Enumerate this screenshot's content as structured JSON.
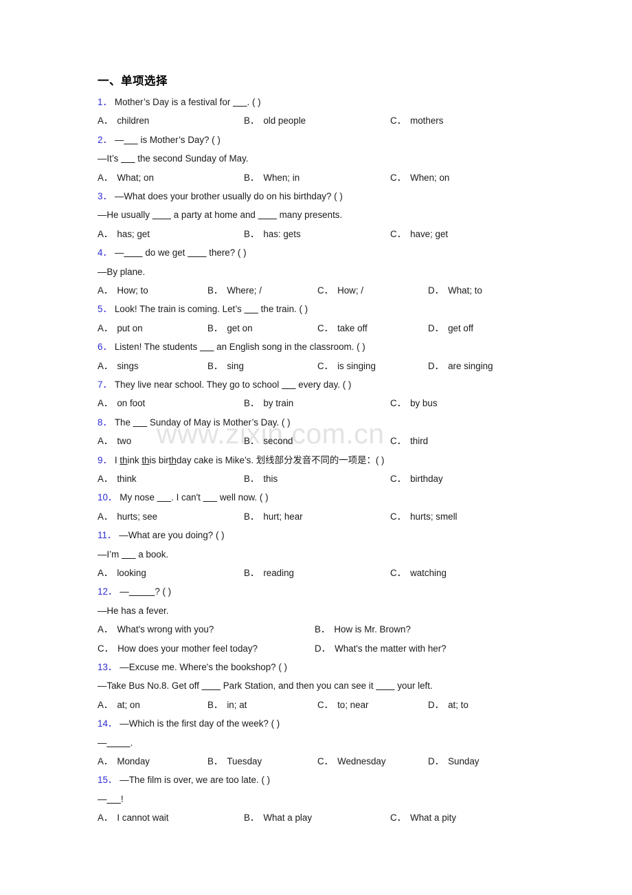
{
  "document": {
    "section_title": "一、单项选择",
    "watermark": "www.zixin.com.cn"
  },
  "questions": [
    {
      "num": "1．",
      "stem": "Mother’s Day is a festival for ______. (   )",
      "cont": null,
      "layout": "c3",
      "options": [
        {
          "letter": "A．",
          "text": "children"
        },
        {
          "letter": "B．",
          "text": "old people"
        },
        {
          "letter": "C．",
          "text": "mothers"
        }
      ]
    },
    {
      "num": "2．",
      "stem": "—______ is Mother’s Day? (   )",
      "cont": "—It’s ______ the second Sunday of May.",
      "layout": "c3",
      "options": [
        {
          "letter": "A．",
          "text": "What; on"
        },
        {
          "letter": "B．",
          "text": "When; in"
        },
        {
          "letter": "C．",
          "text": "When; on"
        }
      ]
    },
    {
      "num": "3．",
      "stem": "—What does your brother usually do on his birthday? (   )",
      "cont": "—He usually ________ a party at home and ________ many presents.",
      "layout": "c3",
      "options": [
        {
          "letter": "A．",
          "text": "has; get"
        },
        {
          "letter": "B．",
          "text": "has: gets"
        },
        {
          "letter": "C．",
          "text": "have; get"
        }
      ]
    },
    {
      "num": "4．",
      "stem": "—________ do we get ________ there? (    )",
      "cont": "—By plane.",
      "layout": "c4",
      "options": [
        {
          "letter": "A．",
          "text": "How; to"
        },
        {
          "letter": "B．",
          "text": "Where; /"
        },
        {
          "letter": "C．",
          "text": "How; /"
        },
        {
          "letter": "D．",
          "text": "What; to"
        }
      ]
    },
    {
      "num": "5．",
      "stem": "Look! The train is coming. Let’s ______ the train. (  )",
      "cont": null,
      "layout": "c4",
      "options": [
        {
          "letter": "A．",
          "text": "put on"
        },
        {
          "letter": "B．",
          "text": "get on"
        },
        {
          "letter": "C．",
          "text": "take off"
        },
        {
          "letter": "D．",
          "text": "get off"
        }
      ]
    },
    {
      "num": "6．",
      "stem": "Listen! The students ______ an English song in the classroom. (  )",
      "cont": null,
      "layout": "c4",
      "options": [
        {
          "letter": "A．",
          "text": "sings"
        },
        {
          "letter": "B．",
          "text": "sing"
        },
        {
          "letter": "C．",
          "text": "is singing"
        },
        {
          "letter": "D．",
          "text": "are singing"
        }
      ]
    },
    {
      "num": "7．",
      "stem": "They live near school. They go to school ______ every day. (  )",
      "cont": null,
      "layout": "c3",
      "options": [
        {
          "letter": "A．",
          "text": "on foot"
        },
        {
          "letter": "B．",
          "text": "by train"
        },
        {
          "letter": "C．",
          "text": "by bus"
        }
      ]
    },
    {
      "num": "8．",
      "stem": "The ______ Sunday of May is Mother’s Day. (  )",
      "cont": null,
      "layout": "c3",
      "options": [
        {
          "letter": "A．",
          "text": "two"
        },
        {
          "letter": "B．",
          "text": "second"
        },
        {
          "letter": "C．",
          "text": "third"
        }
      ]
    },
    {
      "num": "9．",
      "stem": "I think this birthday cake is Mike’s. 划线部分发音不同的一项是：(   )",
      "cont": null,
      "layout": "c3",
      "options": [
        {
          "letter": "A．",
          "text": "think"
        },
        {
          "letter": "B．",
          "text": "this"
        },
        {
          "letter": "C．",
          "text": "birthday"
        }
      ]
    },
    {
      "num": "10．",
      "stem": "My nose ______. I can't ______ well now. (   )",
      "cont": null,
      "layout": "c3",
      "options": [
        {
          "letter": "A．",
          "text": "hurts; see"
        },
        {
          "letter": "B．",
          "text": "hurt; hear"
        },
        {
          "letter": "C．",
          "text": "hurts; smell"
        }
      ]
    },
    {
      "num": "11．",
      "stem": "—What are you doing? (     )",
      "cont": "—I’m ______ a book.",
      "layout": "c3",
      "options": [
        {
          "letter": "A．",
          "text": "looking"
        },
        {
          "letter": "B．",
          "text": "reading"
        },
        {
          "letter": "C．",
          "text": "watching"
        }
      ]
    },
    {
      "num": "12．",
      "stem": "—___________? (   )",
      "cont": "—He has a fever.",
      "layout": "c2",
      "options": [
        {
          "letter": "A．",
          "text": "What's wrong with you?"
        },
        {
          "letter": "B．",
          "text": "How is Mr. Brown?"
        },
        {
          "letter": "C．",
          "text": "How does your mother feel today?"
        },
        {
          "letter": "D．",
          "text": "What's the matter with her?"
        }
      ]
    },
    {
      "num": "13．",
      "stem": "—Excuse me. Where's the bookshop? (  )",
      "cont": "—Take Bus No.8. Get off ________ Park Station, and then you can see it ________ your left.",
      "layout": "c4",
      "options": [
        {
          "letter": "A．",
          "text": "at; on"
        },
        {
          "letter": "B．",
          "text": "in; at"
        },
        {
          "letter": "C．",
          "text": "to; near"
        },
        {
          "letter": "D．",
          "text": "at; to"
        }
      ]
    },
    {
      "num": "14．",
      "stem": "—Which is the first day of the week? (  )",
      "cont": "—__________.",
      "layout": "c4",
      "options": [
        {
          "letter": "A．",
          "text": "Monday"
        },
        {
          "letter": "B．",
          "text": "Tuesday"
        },
        {
          "letter": "C．",
          "text": "Wednesday"
        },
        {
          "letter": "D．",
          "text": "Sunday"
        }
      ]
    },
    {
      "num": "15．",
      "stem": "—The film is over, we are too late. (   )",
      "cont": "—______!",
      "layout": "c3",
      "options": [
        {
          "letter": "A．",
          "text": "I cannot wait"
        },
        {
          "letter": "B．",
          "text": "What a play"
        },
        {
          "letter": "C．",
          "text": "What a pity"
        }
      ]
    }
  ]
}
